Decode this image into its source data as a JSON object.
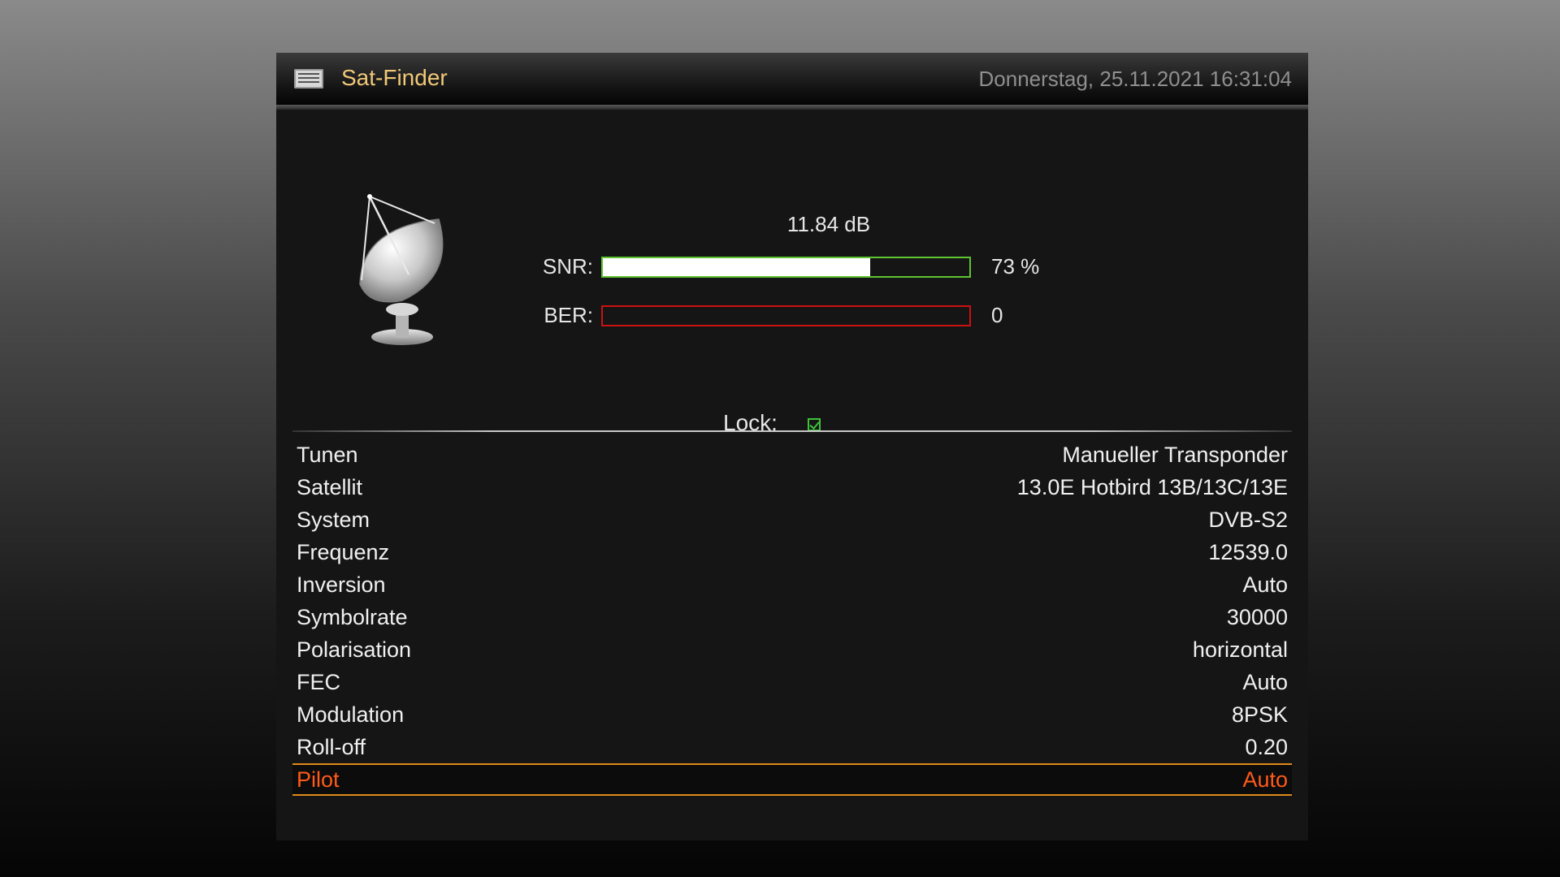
{
  "header": {
    "title": "Sat-Finder",
    "datetime": "Donnerstag, 25.11.2021  16:31:04"
  },
  "signal": {
    "db": "11.84 dB",
    "snr_label": "SNR:",
    "snr_percent_text": "73 %",
    "snr_fraction": 0.73,
    "ber_label": "BER:",
    "ber_value": "0",
    "ber_fraction": 0,
    "lock_label": "Lock:",
    "locked": true
  },
  "colors": {
    "title": "#f0c878",
    "snr_border": "#5ec431",
    "ber_border": "#cc1111",
    "selected_text": "#ff5a1a",
    "selected_border": "#e08a1a",
    "lock_check": "#3fc23a"
  },
  "settings": [
    {
      "label": "Tunen",
      "value": "Manueller Transponder"
    },
    {
      "label": "Satellit",
      "value": "13.0E Hotbird 13B/13C/13E"
    },
    {
      "label": "System",
      "value": "DVB-S2"
    },
    {
      "label": "Frequenz",
      "value": "12539.0"
    },
    {
      "label": "Inversion",
      "value": "Auto"
    },
    {
      "label": "Symbolrate",
      "value": "30000"
    },
    {
      "label": "Polarisation",
      "value": "horizontal"
    },
    {
      "label": "FEC",
      "value": "Auto"
    },
    {
      "label": "Modulation",
      "value": "8PSK"
    },
    {
      "label": "Roll-off",
      "value": "0.20"
    },
    {
      "label": "Pilot",
      "value": "Auto",
      "selected": true
    }
  ],
  "icons": {
    "title_icon": "menu-list-icon",
    "dish_icon": "satellite-dish-icon",
    "lock_icon": "checkbox-checked-icon"
  }
}
